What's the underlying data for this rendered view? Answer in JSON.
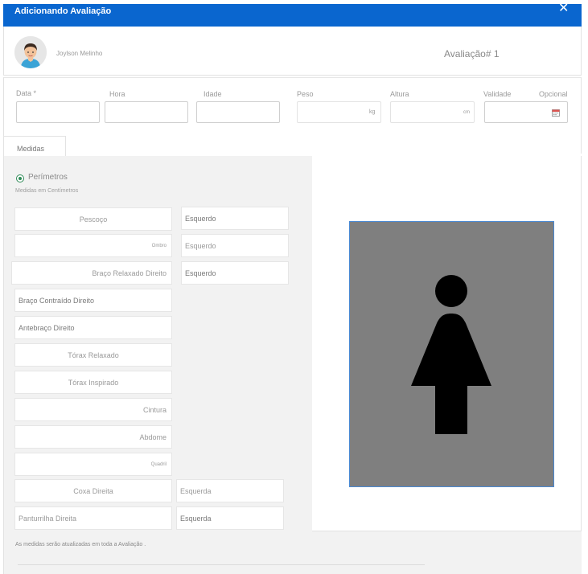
{
  "header": {
    "title": "Adicionando Avaliação",
    "close_icon": "close-icon"
  },
  "user": {
    "name": "Joylson Melinho",
    "avatar_icon": "user-avatar-icon"
  },
  "evaluation": {
    "label": "Avaliação# 1"
  },
  "form": {
    "data_label": "Data *",
    "hora_label": "Hora",
    "idade_label": "Idade",
    "peso_label": "Peso",
    "peso_unit": "kg",
    "altura_label": "Altura",
    "altura_unit": "cm",
    "validade_label": "Validade",
    "opcional_label": "Opcional",
    "calendar_icon": "calendar-icon"
  },
  "tabs": [
    {
      "label": "Medidas"
    }
  ],
  "perimetros": {
    "title": "Perímetros",
    "subtitle": "Medidas em Centímetros",
    "fields": [
      {
        "label": "Pescoço"
      },
      {
        "label": "Ombro"
      },
      {
        "label": "Braço Relaxado Direito"
      },
      {
        "label": "Braço Contraído Direito"
      },
      {
        "label": "Antebraço Direito"
      },
      {
        "label": "Tórax Relaxado"
      },
      {
        "label": "Tórax Inspirado"
      },
      {
        "label": "Cintura"
      },
      {
        "label": "Abdome"
      },
      {
        "label": "Quadril"
      },
      {
        "label": "Coxa Direita"
      },
      {
        "label": "Panturrilha Direita"
      }
    ],
    "side_fields": [
      {
        "label": "Esquerdo"
      },
      {
        "label": "Esquerdo"
      },
      {
        "label": "Esquerdo"
      },
      {
        "label": "Esquerda"
      },
      {
        "label": "Esquerda"
      }
    ],
    "footer_note": "As medidas serão atualizadas em toda a Avaliação ."
  },
  "body_figure": {
    "icon": "female-figure-icon"
  },
  "colors": {
    "header": "#0a66cf",
    "accent_green": "#2e8b57",
    "figure_bg": "#7f7f7f"
  }
}
